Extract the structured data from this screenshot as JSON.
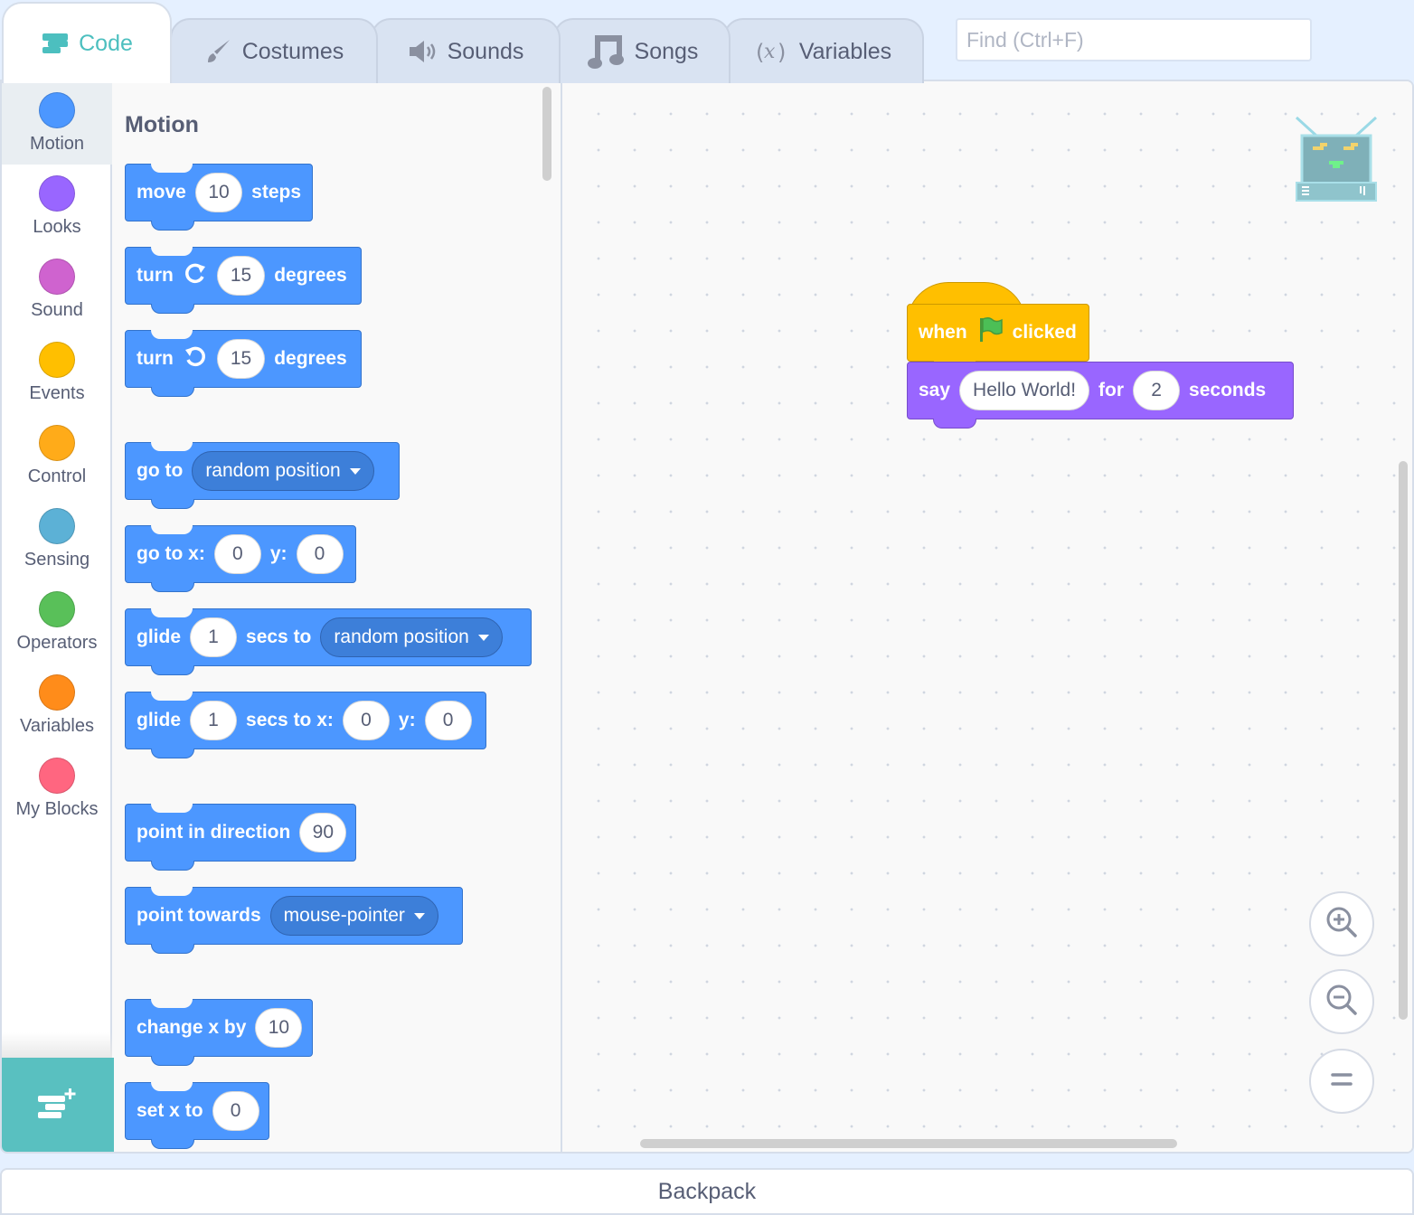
{
  "tabs": [
    {
      "label": "Code",
      "icon": "code-icon",
      "active": true
    },
    {
      "label": "Costumes",
      "icon": "brush-icon",
      "active": false
    },
    {
      "label": "Sounds",
      "icon": "speaker-icon",
      "active": false
    },
    {
      "label": "Songs",
      "icon": "music-note-icon",
      "active": false
    },
    {
      "label": "Variables",
      "icon": "variable-icon",
      "active": false
    }
  ],
  "search": {
    "placeholder": "Find (Ctrl+F)"
  },
  "categories": [
    {
      "label": "Motion",
      "color": "#4c97ff",
      "selected": true
    },
    {
      "label": "Looks",
      "color": "#9966ff"
    },
    {
      "label": "Sound",
      "color": "#cf63cf"
    },
    {
      "label": "Events",
      "color": "#ffbf00"
    },
    {
      "label": "Control",
      "color": "#ffab19"
    },
    {
      "label": "Sensing",
      "color": "#5cb1d6"
    },
    {
      "label": "Operators",
      "color": "#59c059"
    },
    {
      "label": "Variables",
      "color": "#ff8c1a"
    },
    {
      "label": "My Blocks",
      "color": "#ff6680"
    }
  ],
  "palette": {
    "section_title": "Motion",
    "blocks": {
      "move": {
        "t1": "move",
        "v1": "10",
        "t2": "steps"
      },
      "turn_right": {
        "t1": "turn",
        "v1": "15",
        "t2": "degrees"
      },
      "turn_left": {
        "t1": "turn",
        "v1": "15",
        "t2": "degrees"
      },
      "goto": {
        "t1": "go to",
        "dd": "random position"
      },
      "goto_xy": {
        "t1": "go to x:",
        "v1": "0",
        "t2": "y:",
        "v2": "0"
      },
      "glide_to": {
        "t1": "glide",
        "v1": "1",
        "t2": "secs to",
        "dd": "random position"
      },
      "glide_xy": {
        "t1": "glide",
        "v1": "1",
        "t2": "secs to x:",
        "v2": "0",
        "t3": "y:",
        "v3": "0"
      },
      "point_dir": {
        "t1": "point in direction",
        "v1": "90"
      },
      "point_towards": {
        "t1": "point towards",
        "dd": "mouse-pointer"
      },
      "change_x": {
        "t1": "change x by",
        "v1": "10"
      },
      "set_x": {
        "t1": "set x to",
        "v1": "0"
      }
    }
  },
  "script": {
    "hat": {
      "t1": "when",
      "icon": "green-flag-icon",
      "t2": "clicked"
    },
    "say": {
      "t1": "say",
      "v1": "Hello World!",
      "t2": "for",
      "v2": "2",
      "t3": "seconds"
    }
  },
  "backpack": {
    "label": "Backpack"
  },
  "colors": {
    "accent": "#4cbfbf",
    "motion": "#4c97ff",
    "looks": "#9966ff",
    "events": "#ffbf00"
  }
}
